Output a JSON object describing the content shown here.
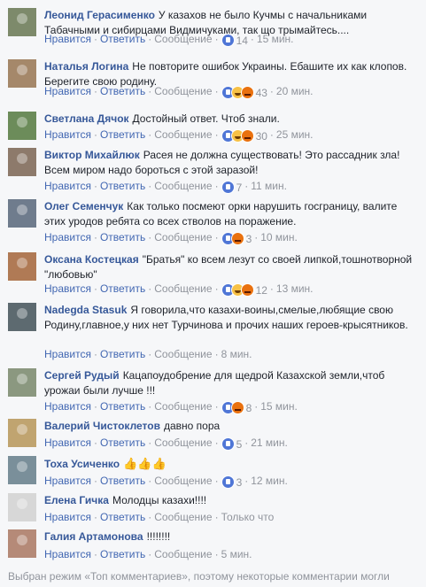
{
  "colors": {
    "background": "#f6f7f9",
    "author": "#365899",
    "link": "#4267b2",
    "muted": "#90949c",
    "text": "#1d2129",
    "like_blue": "#4f76d6",
    "haha_yellow": "#f7c146",
    "angry_orange": "#e9710f"
  },
  "actions": {
    "like": "Нравится",
    "reply": "Ответить",
    "message": "Сообщение",
    "sep": "·"
  },
  "comments": [
    {
      "author": "Леонид Герасименко",
      "text": "У казахов не было Кучмы с начальниками Табачными и сибирцами Видмичуками, так що трымайтесь....",
      "reactions": [
        "like"
      ],
      "count": "14",
      "time": "15 мин."
    },
    {
      "author": "Наталья Логина",
      "text": "Не повторите ошибок Украины. Ебашите их как клопов. Берегите свою родину.",
      "reactions": [
        "like",
        "haha",
        "angry"
      ],
      "count": "43",
      "time": "20 мин."
    },
    {
      "author": "Светлана Дячок",
      "text": "Достойный ответ. Чтоб знали.",
      "reactions": [
        "like",
        "haha",
        "angry"
      ],
      "count": "30",
      "time": "25 мин."
    },
    {
      "author": "Виктор Михайлюк",
      "text": "Расея не должна существовать! Это рассадник зла! Всем миром надо бороться с этой заразой!",
      "reactions": [
        "like"
      ],
      "count": "7",
      "time": "11 мин."
    },
    {
      "author": "Олег Семенчук",
      "text": "Как только посмеют орки нарушить госграницу, валите этих уродов ребята со всех стволов на поражение.",
      "reactions": [
        "like",
        "angry"
      ],
      "count": "3",
      "time": "10 мин."
    },
    {
      "author": "Оксана Костецкая",
      "text": "\"Братья\" ко всем лезут со своей липкой,тошнотворной \"любовью\"",
      "reactions": [
        "like",
        "haha",
        "angry"
      ],
      "count": "12",
      "time": "13 мин."
    },
    {
      "author": "Nadegda Stasuk",
      "text": "Я говорила,что казахи-воины,смелые,любящие свою Родину,главное,у них нет Турчинова и прочих наших героев-крысятников.",
      "reactions": [],
      "count": "",
      "time": "8 мин."
    },
    {
      "author": "Сергей Рудый",
      "text": "Кацапоудобрение для щедрой Казахской земли,чтоб урожаи были лучше !!!",
      "reactions": [
        "like",
        "angry"
      ],
      "count": "8",
      "time": "15 мин."
    },
    {
      "author": "Валерий Чистоклетов",
      "text": "давно пора",
      "reactions": [
        "like"
      ],
      "count": "5",
      "time": "21 мин."
    },
    {
      "author": "Тоха Усиченко",
      "text": "👍👍👍",
      "reactions": [
        "like"
      ],
      "count": "3",
      "time": "12 мин."
    },
    {
      "author": "Елена Гичка",
      "text": "Молодцы казахи!!!!",
      "reactions": [],
      "count": "",
      "time": "Только что"
    },
    {
      "author": "Галия Артамонова",
      "text": "!!!!!!!!",
      "reactions": [],
      "count": "",
      "time": "5 мин."
    }
  ],
  "footer": "Выбран режим «Топ комментариев», поэтому некоторые комментарии могли"
}
